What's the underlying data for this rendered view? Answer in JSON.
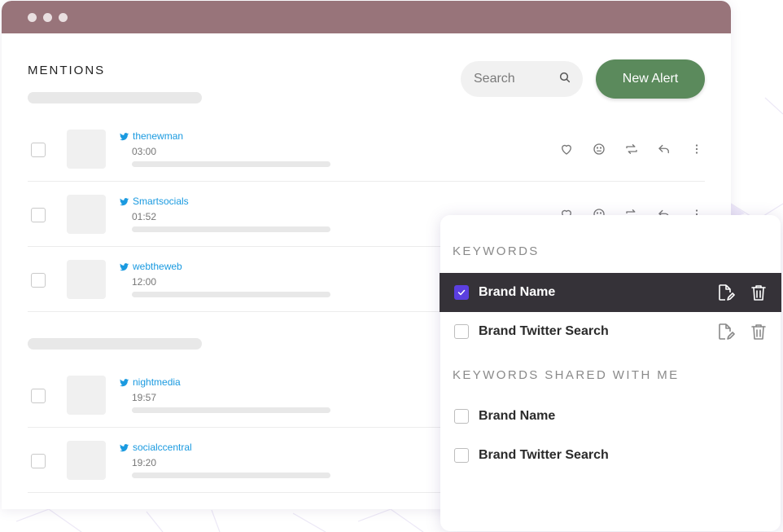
{
  "window": {
    "title_dots": [
      "close",
      "minimize",
      "maximize"
    ]
  },
  "header": {
    "title": "MENTIONS",
    "search_placeholder": "Search",
    "search_icon": "search-icon",
    "new_alert_label": "New Alert"
  },
  "mentions": [
    {
      "handle": "thenewman",
      "time": "03:00"
    },
    {
      "handle": "Smartsocials",
      "time": "01:52"
    },
    {
      "handle": "webtheweb",
      "time": "12:00"
    },
    {
      "handle": "nightmedia",
      "time": "19:57"
    },
    {
      "handle": "socialccentral",
      "time": "19:20"
    }
  ],
  "row_actions": [
    "heart-icon",
    "emoji-icon",
    "retweet-icon",
    "reply-icon",
    "more-vertical-icon"
  ],
  "keywords_panel": {
    "keywords_title": "KEYWORDS",
    "keywords": [
      {
        "label": "Brand Name",
        "checked": true
      },
      {
        "label": "Brand Twitter Search",
        "checked": false
      }
    ],
    "shared_title": "KEYWORDS SHARED WITH ME",
    "shared": [
      {
        "label": "Brand Name",
        "checked": false
      },
      {
        "label": "Brand Twitter Search",
        "checked": false
      }
    ]
  },
  "colors": {
    "titlebar": "#98747a",
    "accent_button": "#5b8a5c",
    "twitter_blue": "#1a9ae0",
    "selected_row": "#353238",
    "checkbox_checked": "#5b3fe0"
  }
}
